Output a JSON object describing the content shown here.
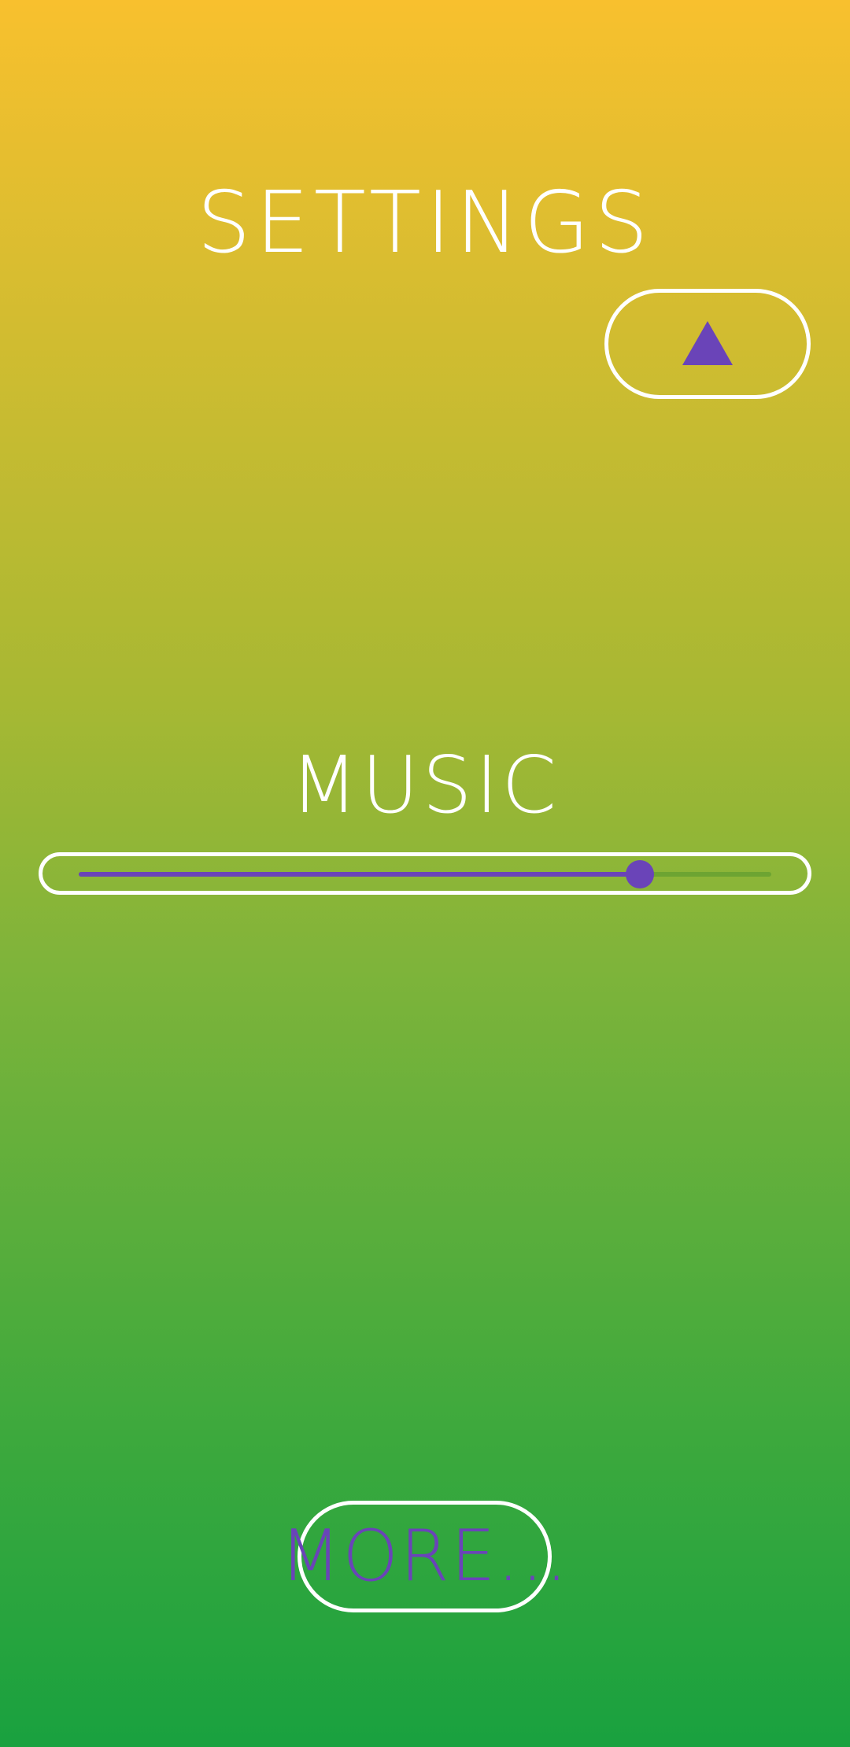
{
  "header": {
    "title": "SETTINGS"
  },
  "up_button": {
    "icon": "triangle-up-icon"
  },
  "music": {
    "label": "MUSIC",
    "volume": 0.81
  },
  "more_button": {
    "label": "MORE..."
  },
  "colors": {
    "accent": "#6a44b8",
    "gradient_top": "#f8c02e",
    "gradient_bottom": "#19a13f",
    "outline": "#ffffff"
  }
}
